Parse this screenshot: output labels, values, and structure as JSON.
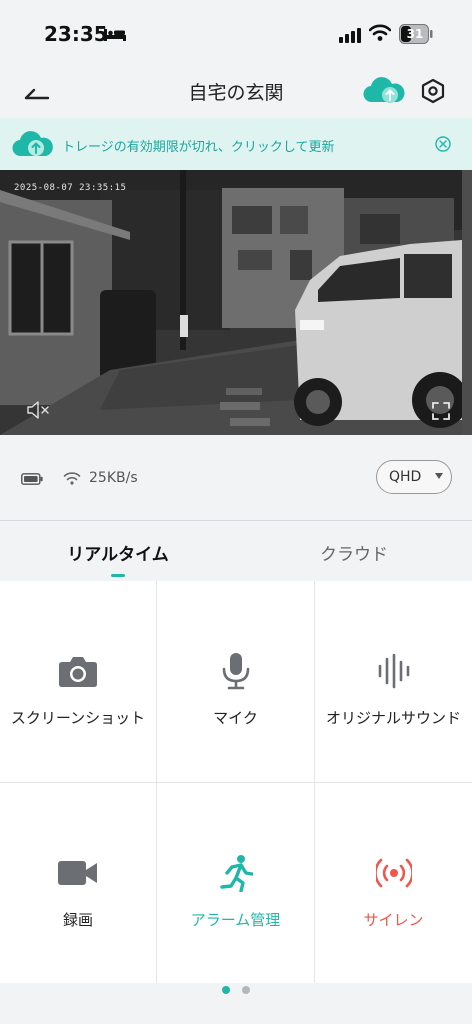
{
  "status": {
    "time": "23:35",
    "battery": "31"
  },
  "header": {
    "title": "自宅の玄関"
  },
  "banner": {
    "text": "トレージの有効期限が切れ、クリックして更新"
  },
  "video": {
    "timestamp": "2025-08-07 23:35:15"
  },
  "info": {
    "speed": "25KB/s",
    "quality": "QHD"
  },
  "tabs": [
    {
      "label": "リアルタイム",
      "active": true
    },
    {
      "label": "クラウド",
      "active": false
    }
  ],
  "controls": [
    {
      "label": "スクリーンショット",
      "icon": "camera-icon"
    },
    {
      "label": "マイク",
      "icon": "microphone-icon"
    },
    {
      "label": "オリジナルサウンド",
      "icon": "sound-wave-icon"
    },
    {
      "label": "録画",
      "icon": "video-camera-icon"
    },
    {
      "label": "アラーム管理",
      "icon": "running-person-icon"
    },
    {
      "label": "サイレン",
      "icon": "siren-icon"
    }
  ],
  "colors": {
    "accent": "#1fb8a8",
    "alert": "#f0564b",
    "banner_bg": "#dff3f1"
  },
  "pager": {
    "pages": 2,
    "current": 1
  }
}
